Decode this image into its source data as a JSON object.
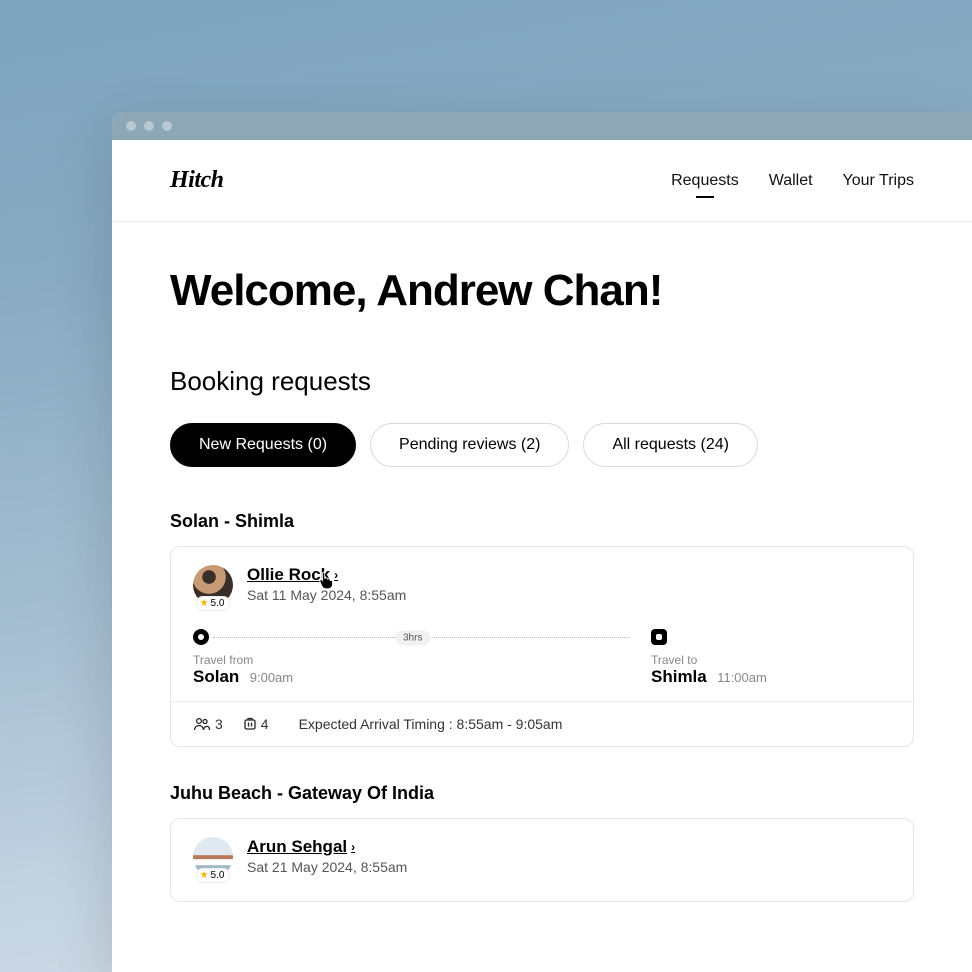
{
  "brand": "Hitch",
  "nav": {
    "requests": "Requests",
    "wallet": "Wallet",
    "trips": "Your Trips"
  },
  "welcome": "Welcome, Andrew Chan!",
  "section_title": "Booking requests",
  "chips": {
    "new": "New Requests (0)",
    "pending": "Pending reviews (2)",
    "all": "All requests (24)"
  },
  "requests": [
    {
      "route": "Solan - Shimla",
      "name": "Ollie Rock",
      "rating": "5.0",
      "datetime": "Sat 11 May 2024, 8:55am",
      "from_label": "Travel from",
      "from_city": "Solan",
      "from_time": "9:00am",
      "duration": "3hrs",
      "to_label": "Travel to",
      "to_city": "Shimla",
      "to_time": "11:00am",
      "pax": "3",
      "bags": "4",
      "eta_label": "Expected Arrival Timing : 8:55am - 9:05am"
    },
    {
      "route": "Juhu Beach - Gateway Of India",
      "name": "Arun Sehgal",
      "rating": "5.0",
      "datetime": "Sat 21 May 2024, 8:55am"
    }
  ]
}
